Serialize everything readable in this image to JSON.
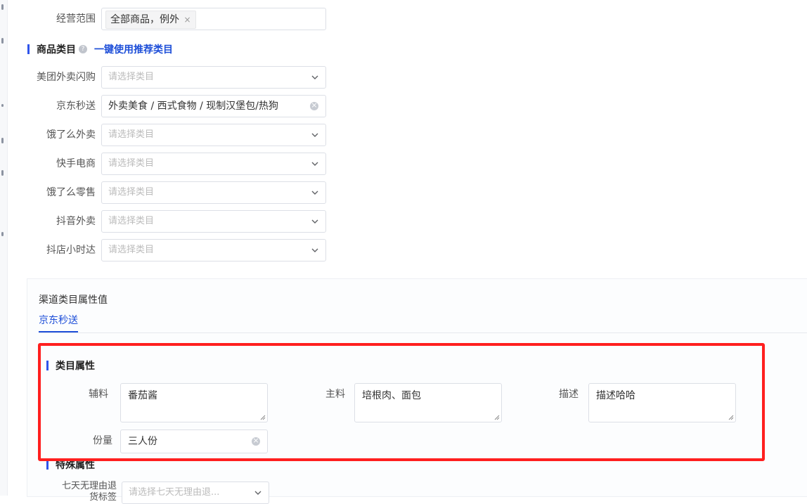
{
  "scope": {
    "label": "经营范围",
    "tag": "全部商品，例外",
    "tag_close": "×"
  },
  "category_section": {
    "title": "商品类目",
    "help": "?",
    "quick_link": "一键使用推荐类目"
  },
  "channels": [
    {
      "label": "美团外卖闪购",
      "placeholder": "请选择类目",
      "value": ""
    },
    {
      "label": "京东秒送",
      "placeholder": "",
      "value": "外卖美食 / 西式食物 / 现制汉堡包/热狗"
    },
    {
      "label": "饿了么外卖",
      "placeholder": "请选择类目",
      "value": ""
    },
    {
      "label": "快手电商",
      "placeholder": "请选择类目",
      "value": ""
    },
    {
      "label": "饿了么零售",
      "placeholder": "请选择类目",
      "value": ""
    },
    {
      "label": "抖音外卖",
      "placeholder": "请选择类目",
      "value": ""
    },
    {
      "label": "抖店小时达",
      "placeholder": "请选择类目",
      "value": ""
    }
  ],
  "attr_panel": {
    "title": "渠道类目属性值",
    "active_tab": "京东秒送",
    "category_attrs_title": "类目属性",
    "fields": {
      "auxiliary": {
        "label": "辅料",
        "value": "番茄酱"
      },
      "main": {
        "label": "主料",
        "value": "培根肉、面包"
      },
      "description": {
        "label": "描述",
        "value": "描述哈哈"
      },
      "portion": {
        "label": "份量",
        "value": "三人份"
      }
    },
    "special_attrs_title": "特殊属性",
    "return_policy": {
      "label_line1": "七天无理由退",
      "label_line2": "货标签",
      "placeholder": "请选择七天无理由退..."
    }
  },
  "colors": {
    "accent": "#1d4ed8",
    "highlight": "#ff1f1f",
    "section_bar": "#2f54eb"
  }
}
